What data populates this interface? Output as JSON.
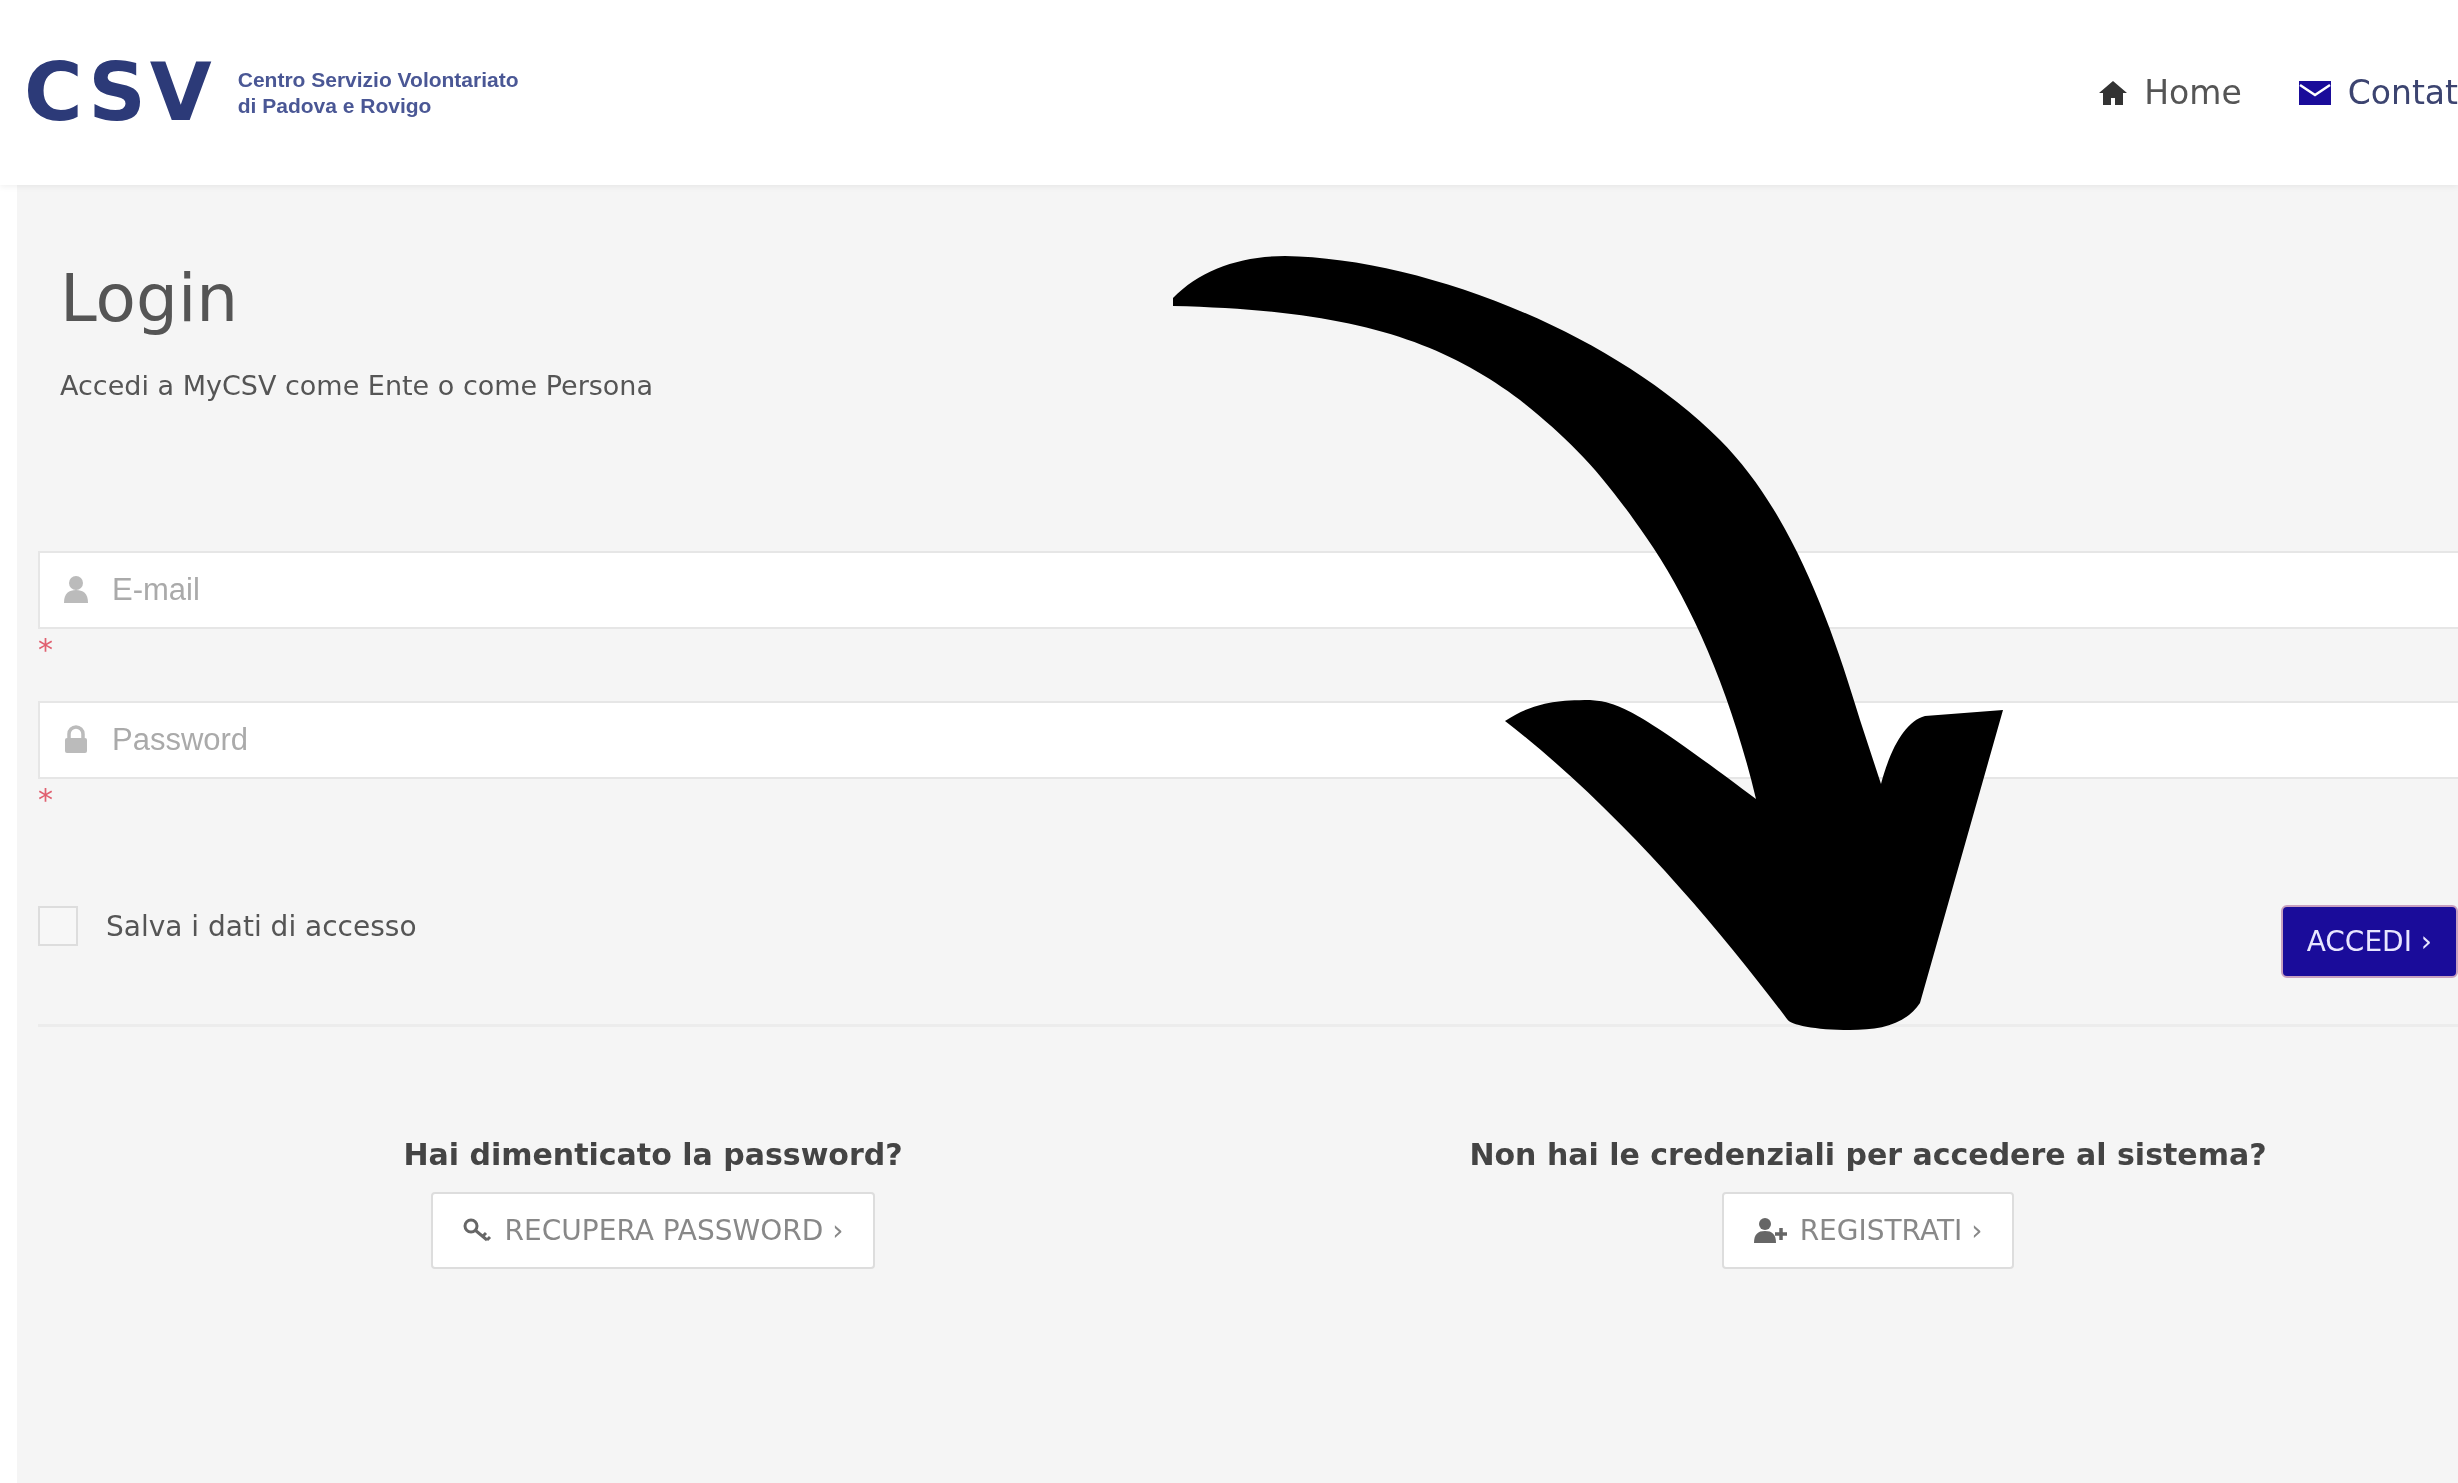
{
  "header": {
    "logo": {
      "mark": "CSV",
      "line1": "Centro Servizio Volontariato",
      "line2": "di Padova e Rovigo"
    },
    "nav": [
      {
        "kind": "home",
        "label": "Home"
      },
      {
        "kind": "mail",
        "label": "Contat"
      }
    ]
  },
  "login": {
    "title": "Login",
    "subtitle": "Accedi a MyCSV come Ente o come Persona",
    "fields": [
      {
        "kind": "email",
        "placeholder": "E-mail",
        "required_mark": "*"
      },
      {
        "kind": "password",
        "placeholder": "Password",
        "required_mark": "*"
      }
    ],
    "remember": {
      "label": "Salva i dati di accesso",
      "checked": false
    },
    "submit": "ACCEDI ›"
  },
  "help": [
    {
      "kind": "recover",
      "question": "Hai dimenticato la password?",
      "button": "RECUPERA PASSWORD ›"
    },
    {
      "kind": "register",
      "question": "Non hai le credenziali per accedere al sistema?",
      "button": "REGISTRATI ›"
    }
  ]
}
